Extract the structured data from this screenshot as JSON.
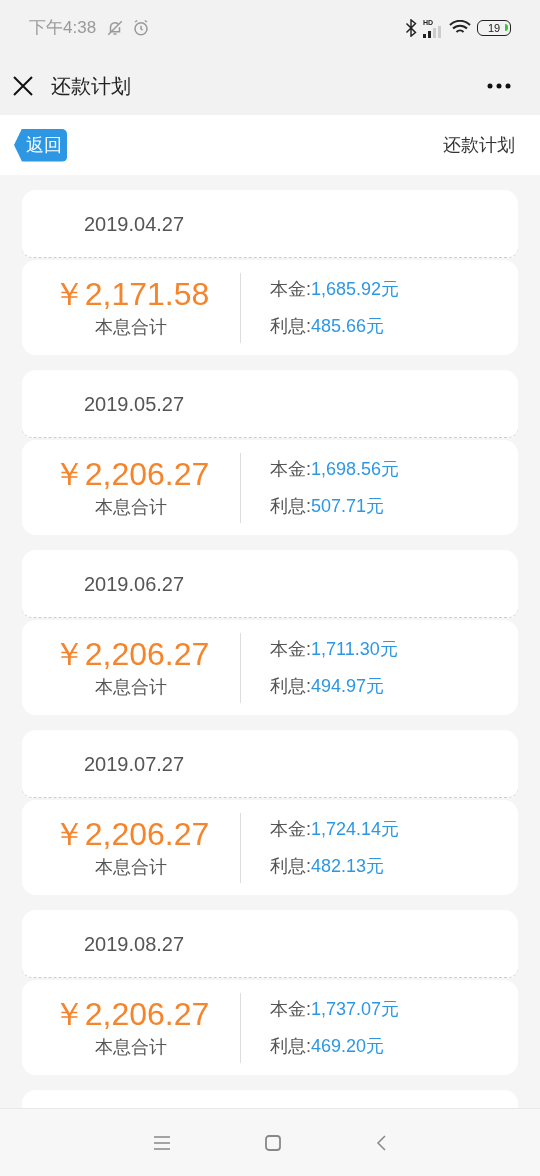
{
  "status_bar": {
    "time": "下午4:38",
    "network_label": "HD",
    "battery": "19"
  },
  "header": {
    "title": "还款计划"
  },
  "subheader": {
    "back_button": "返回",
    "title": "还款计划"
  },
  "plans": [
    {
      "date": "2019.04.27",
      "total": "￥2,171.58",
      "total_label": "本息合计",
      "principal_label": "本金:",
      "principal": "1,685.92元",
      "interest_label": "利息:",
      "interest": "485.66元"
    },
    {
      "date": "2019.05.27",
      "total": "￥2,206.27",
      "total_label": "本息合计",
      "principal_label": "本金:",
      "principal": "1,698.56元",
      "interest_label": "利息:",
      "interest": "507.71元"
    },
    {
      "date": "2019.06.27",
      "total": "￥2,206.27",
      "total_label": "本息合计",
      "principal_label": "本金:",
      "principal": "1,711.30元",
      "interest_label": "利息:",
      "interest": "494.97元"
    },
    {
      "date": "2019.07.27",
      "total": "￥2,206.27",
      "total_label": "本息合计",
      "principal_label": "本金:",
      "principal": "1,724.14元",
      "interest_label": "利息:",
      "interest": "482.13元"
    },
    {
      "date": "2019.08.27",
      "total": "￥2,206.27",
      "total_label": "本息合计",
      "principal_label": "本金:",
      "principal": "1,737.07元",
      "interest_label": "利息:",
      "interest": "469.20元"
    }
  ]
}
